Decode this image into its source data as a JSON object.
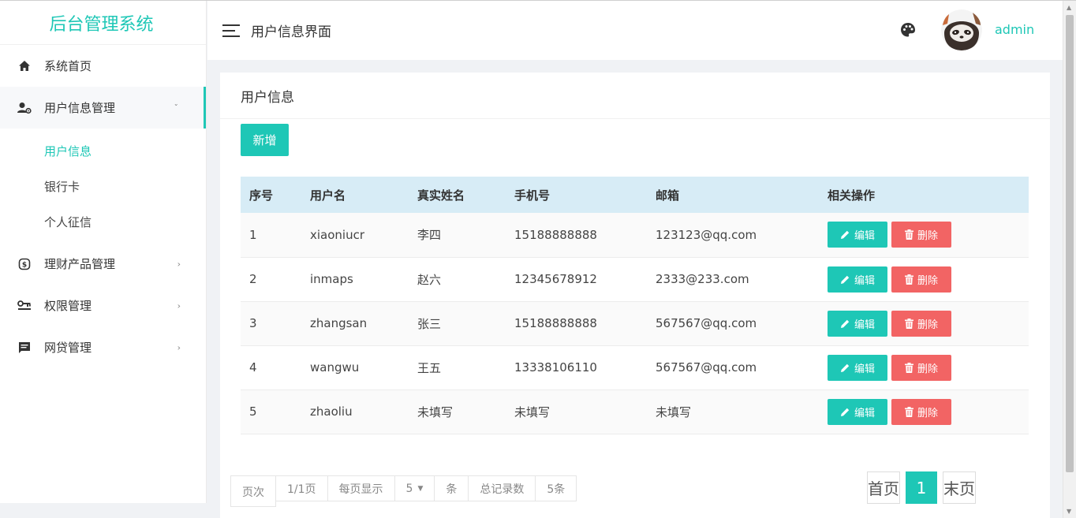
{
  "app": {
    "brand": "后台管理系统"
  },
  "header": {
    "title": "用户信息界面",
    "user": "admin"
  },
  "sidebar": {
    "items": [
      {
        "label": "系统首页",
        "icon": "home-icon"
      },
      {
        "label": "用户信息管理",
        "icon": "user-settings-icon",
        "arrow": "ˇ",
        "children": [
          {
            "label": "用户信息"
          },
          {
            "label": "银行卡"
          },
          {
            "label": "个人征信"
          }
        ]
      },
      {
        "label": "理财产品管理",
        "icon": "finance-icon",
        "arrow": "›"
      },
      {
        "label": "权限管理",
        "icon": "key-icon",
        "arrow": "›"
      },
      {
        "label": "网贷管理",
        "icon": "message-icon",
        "arrow": "›"
      }
    ]
  },
  "card": {
    "title": "用户信息",
    "add_label": "新增"
  },
  "table": {
    "headers": [
      "序号",
      "用户名",
      "真实姓名",
      "手机号",
      "邮箱",
      "相关操作"
    ],
    "rows": [
      [
        "1",
        "xiaoniucr",
        "李四",
        "15188888888",
        "123123@qq.com"
      ],
      [
        "2",
        "inmaps",
        "赵六",
        "12345678912",
        "2333@233.com"
      ],
      [
        "3",
        "zhangsan",
        "张三",
        "15188888888",
        "567567@qq.com"
      ],
      [
        "4",
        "wangwu",
        "王五",
        "13338106110",
        "567567@qq.com"
      ],
      [
        "5",
        "zhaoliu",
        "未填写",
        "未填写",
        "未填写"
      ]
    ],
    "edit_label": "编辑",
    "delete_label": "删除"
  },
  "pager_info": {
    "page_label": "页次",
    "page_value": "1/1页",
    "per_page_label": "每页显示",
    "per_page_value": "5",
    "per_page_unit": "条",
    "total_label": "总记录数",
    "total_value": "5条"
  },
  "pager": {
    "first": "首页",
    "current": "1",
    "last": "末页"
  },
  "colors": {
    "accent": "#1ec7b6",
    "danger": "#f26464",
    "table_header": "#d7ecf6"
  }
}
